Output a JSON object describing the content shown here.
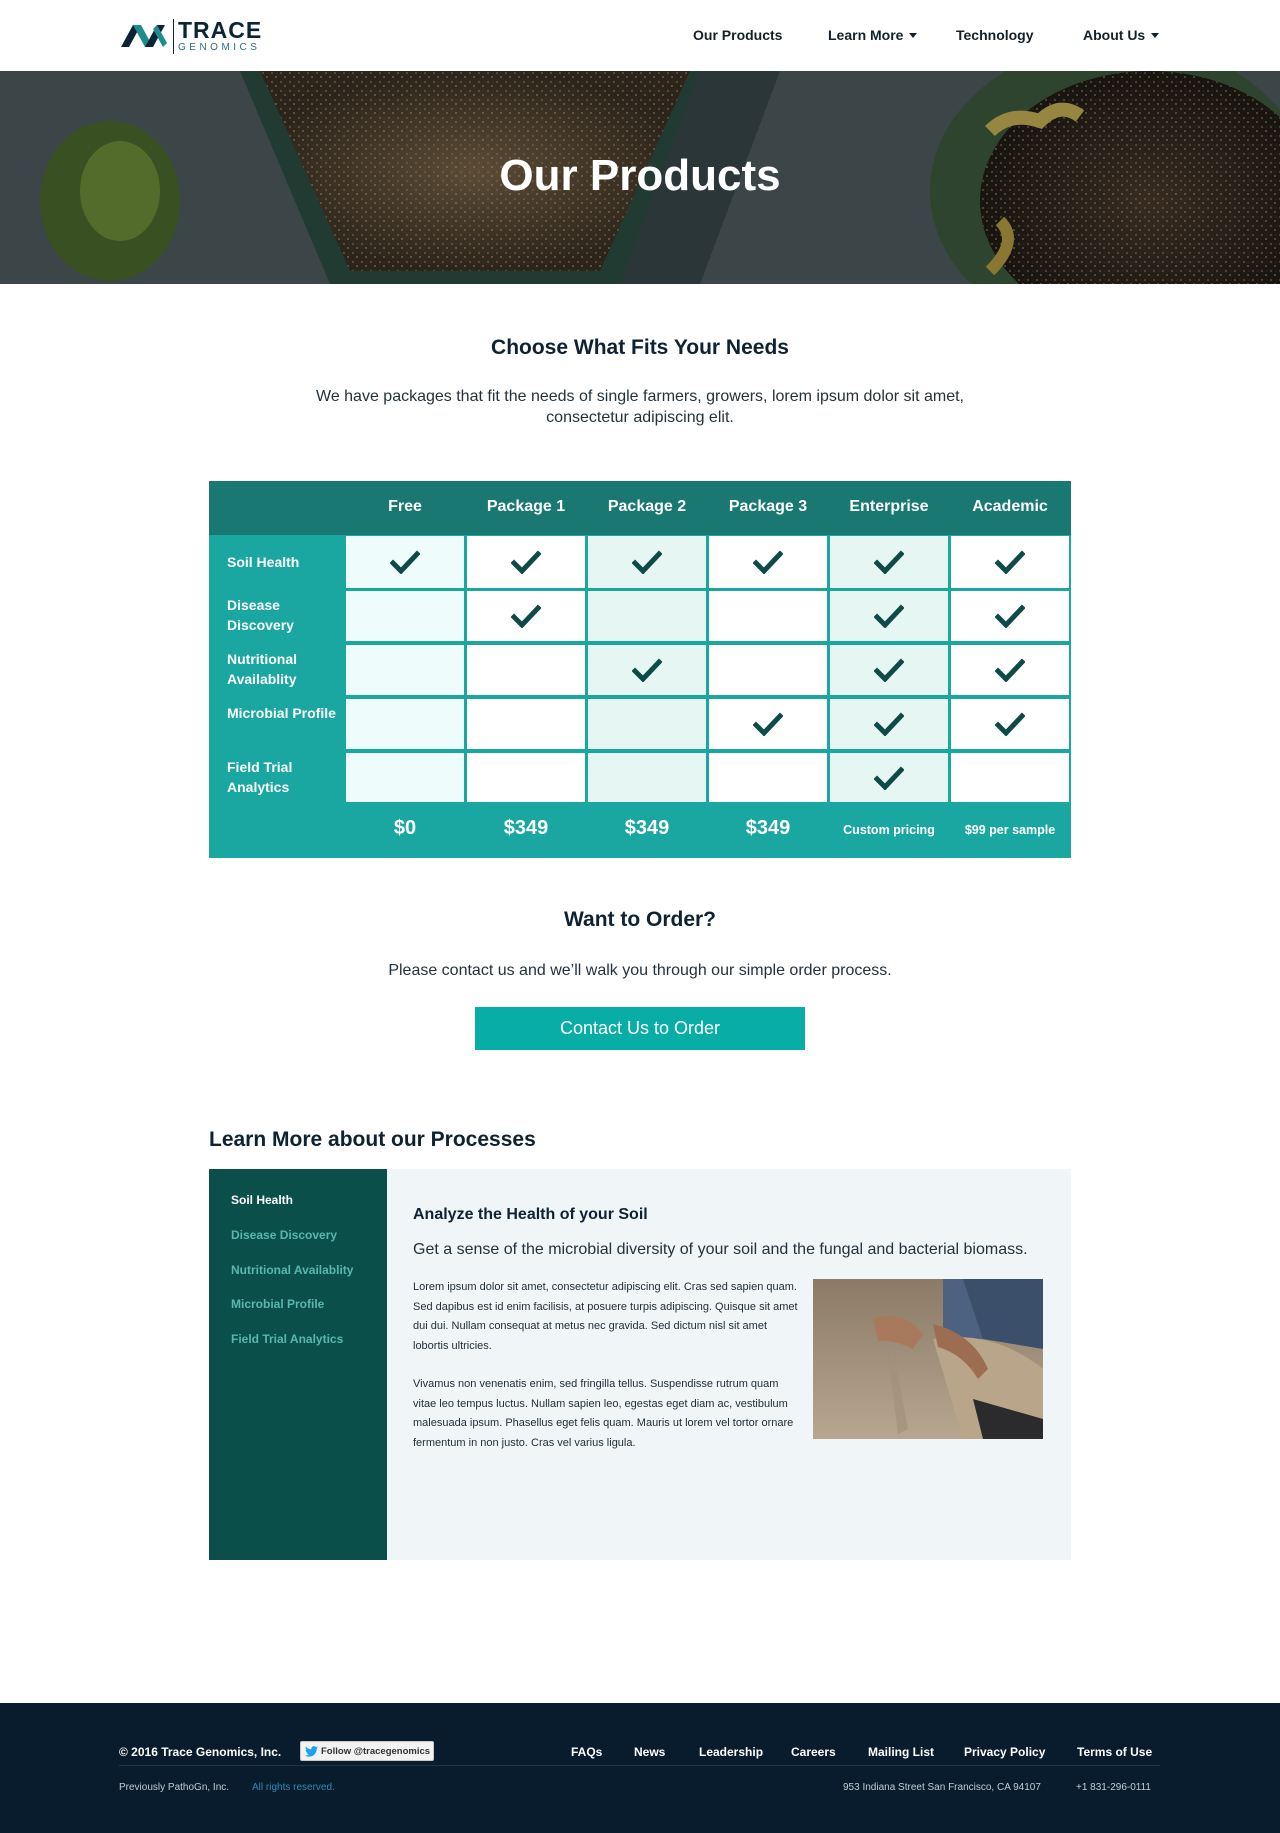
{
  "brand": {
    "name": "TRACE",
    "sub": "GENOMICS"
  },
  "nav": {
    "items": [
      {
        "label": "Our Products"
      },
      {
        "label": "Learn More"
      },
      {
        "label": "Technology"
      },
      {
        "label": "About Us"
      }
    ]
  },
  "hero": {
    "title": "Our Products"
  },
  "intro": {
    "title": "Choose What Fits Your Needs",
    "text": "We have packages that fit the needs of single farmers, growers, lorem ipsum dolor sit amet, consectetur adipiscing elit."
  },
  "pricing": {
    "columns": [
      "Free",
      "Package 1",
      "Package 2",
      "Package 3",
      "Enterprise",
      "Academic"
    ],
    "rows": [
      {
        "label": "Soil Health",
        "checks": [
          true,
          true,
          true,
          true,
          true,
          true
        ]
      },
      {
        "label": "Disease Discovery",
        "checks": [
          false,
          true,
          false,
          false,
          true,
          true
        ]
      },
      {
        "label": "Nutritional Availablity",
        "checks": [
          false,
          false,
          true,
          false,
          true,
          true
        ]
      },
      {
        "label": "Microbial Profile",
        "checks": [
          false,
          false,
          false,
          true,
          true,
          true
        ]
      },
      {
        "label": "Field Trial Analytics",
        "checks": [
          false,
          false,
          false,
          false,
          true,
          false
        ]
      }
    ],
    "prices": [
      "$0",
      "$349",
      "$349",
      "$349",
      "Custom pricing",
      "$99 per sample"
    ]
  },
  "order": {
    "title": "Want to Order?",
    "text": "Please contact us and we’ll walk you through our simple order process.",
    "button": "Contact Us to Order"
  },
  "learn_more": {
    "title": "Learn More about our Processes",
    "tabs": [
      "Soil Health",
      "Disease Discovery",
      "Nutritional Availablity",
      "Microbial Profile",
      "Field Trial Analytics"
    ],
    "active_tab": "Soil Health",
    "heading": "Analyze the Health of your Soil",
    "subheading": "Get a sense of the microbial diversity of your soil and the fungal and bacterial biomass.",
    "paragraph1": "Lorem ipsum dolor sit amet, consectetur adipiscing elit. Cras sed sapien quam. Sed dapibus est id enim facilisis, at posuere turpis adipiscing. Quisque sit amet dui dui. Nullam consequat at metus nec gravida. Sed dictum nisl sit amet lobortis ultricies.",
    "paragraph2": "Vivamus non venenatis enim, sed fringilla tellus. Suspendisse rutrum quam vitae leo tempus luctus. Nullam sapien leo, egestas eget diam ac, vestibulum malesuada ipsum. Phasellus eget felis quam. Mauris ut lorem vel tortor ornare fermentum in non justo. Cras vel varius ligula."
  },
  "footer": {
    "copyright": "© 2016 Trace Genomics, Inc.",
    "follow": "Follow @tracegenomics",
    "links": [
      "FAQs",
      "News",
      "Leadership",
      "Careers",
      "Mailing List",
      "Privacy Policy",
      "Terms of  Use"
    ],
    "previously": "Previously PathoGn, Inc.",
    "rights": "All rights reserved.",
    "address": "953 Indiana Street  San Francisco, CA 94107",
    "phone": "+1 831-296-0111"
  },
  "colors": {
    "teal": "#1aa7a1",
    "dark_teal": "#197872",
    "sidebar": "#0a4f4a",
    "check": "#0e4a48",
    "footer": "#081c2d",
    "button": "#08ada6"
  }
}
